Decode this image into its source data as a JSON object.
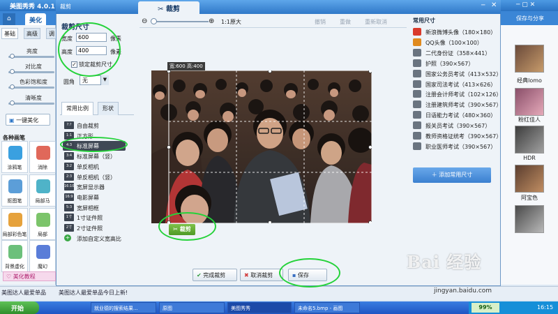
{
  "app": {
    "title": "美图秀秀 4.0.1",
    "login": "登录",
    "tabs": {
      "beauty": "美化"
    },
    "subtabs": [
      "基础",
      "高级",
      "调"
    ],
    "sliders": [
      "亮度",
      "对比度",
      "色彩饱和度",
      "清晰度"
    ],
    "one_click": "一键美化",
    "brushes_title": "各种画笔",
    "brushes": [
      "涂鸦笔",
      "消除",
      "抠图笔",
      "局部马",
      "局部彩色笔",
      "局部",
      "背景虚化",
      "魔幻"
    ],
    "tutorial": "美化教程",
    "status_left": "美图达人最爱单品",
    "save_share": "保存与分享",
    "thumbs": [
      "经典lomo",
      "粉红佳人",
      "HDR",
      "阿宝色",
      ""
    ]
  },
  "dialog": {
    "title": "裁剪",
    "tab": "裁剪",
    "crop_size_title": "裁剪尺寸",
    "width_label": "宽度",
    "height_label": "高度",
    "width_value": "600",
    "height_value": "400",
    "unit": "像素",
    "lock_label": "锁定裁剪尺寸",
    "lock_checked": "✓",
    "corner_label": "圆角",
    "corner_value": "无",
    "ratio_tabs": [
      "常用比例",
      "形状"
    ],
    "ratios": [
      {
        "icon": "?:?",
        "label": "自由裁剪"
      },
      {
        "icon": "1:1",
        "label": "正方形"
      },
      {
        "icon": "4:3",
        "label": "标准屏幕"
      },
      {
        "icon": "3:4",
        "label": "标准屏幕（竖）"
      },
      {
        "icon": "3:2",
        "label": "单反相机"
      },
      {
        "icon": "2:3",
        "label": "单反相机（竖）"
      },
      {
        "icon": "16:10",
        "label": "宽屏显示器"
      },
      {
        "icon": "16:9",
        "label": "电影屏幕"
      },
      {
        "icon": "5:3",
        "label": "宽屏相框"
      },
      {
        "icon": "1寸",
        "label": "1寸证件照"
      },
      {
        "icon": "2寸",
        "label": "2寸证件照"
      },
      {
        "icon": "+",
        "label": "添加自定义宽高比"
      }
    ],
    "zoom": {
      "original": "1:1原大"
    },
    "history": [
      "撤销",
      "重做",
      "重新取消"
    ],
    "canvas_dim": "宽:600  高:400",
    "crop_button": "裁剪",
    "buttons": {
      "done": "完成裁剪",
      "cancel": "取消裁剪",
      "save": "保存"
    },
    "common_title": "常用尺寸",
    "presets": [
      "新浪微博头像（180×180）",
      "QQ头像（100×100）",
      "二代身份证（358×441）",
      "护照（390×567）",
      "国家公务员考试（413×532）",
      "国家司法考试（413×626）",
      "注册会计师考试（102×126）",
      "注册建筑师考试（390×567）",
      "日语能力考试（480×360）",
      "报关员考试（390×567）",
      "教师资格证统考（390×567）",
      "职业医师考试（390×567）"
    ],
    "add_preset": "添加常用尺寸",
    "status_right": "美图达人最爱单品今日上新!"
  },
  "taskbar": {
    "start": "开始",
    "tasks": [
      "就业德的搜索结果...",
      "原图",
      "美图秀秀",
      "未命名5.bmp - 画图"
    ],
    "percent": "99%",
    "clock": "16:15"
  },
  "watermark": {
    "text": "Bai 经验",
    "url": "jingyan.baidu.com"
  },
  "colors": {
    "accent": "#2f78c8",
    "highlight_ring": "#25d23a",
    "crop_green": "#4f9a26"
  }
}
